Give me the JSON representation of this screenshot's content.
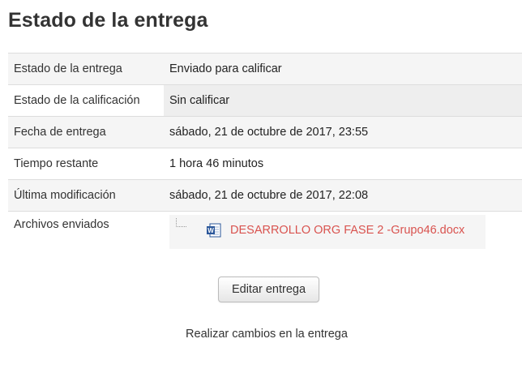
{
  "page": {
    "title": "Estado de la entrega"
  },
  "status_table": {
    "rows": [
      {
        "label": "Estado de la entrega",
        "value": "Enviado para calificar"
      },
      {
        "label": "Estado de la calificación",
        "value": "Sin calificar"
      },
      {
        "label": "Fecha de entrega",
        "value": "sábado, 21 de octubre de 2017, 23:55"
      },
      {
        "label": "Tiempo restante",
        "value": "1 hora 46 minutos"
      },
      {
        "label": "Última modificación",
        "value": "sábado, 21 de octubre de 2017, 22:08"
      },
      {
        "label": "Archivos enviados"
      }
    ],
    "file": {
      "name": "DESARROLLO ORG FASE 2 -Grupo46.docx",
      "icon": "word-document-icon"
    }
  },
  "actions": {
    "edit_button_label": "Editar entrega",
    "edit_help": "Realizar cambios en la entrega"
  },
  "colors": {
    "file_link": "#d9534f",
    "text": "#333333",
    "row_shade": "#f5f5f5"
  }
}
